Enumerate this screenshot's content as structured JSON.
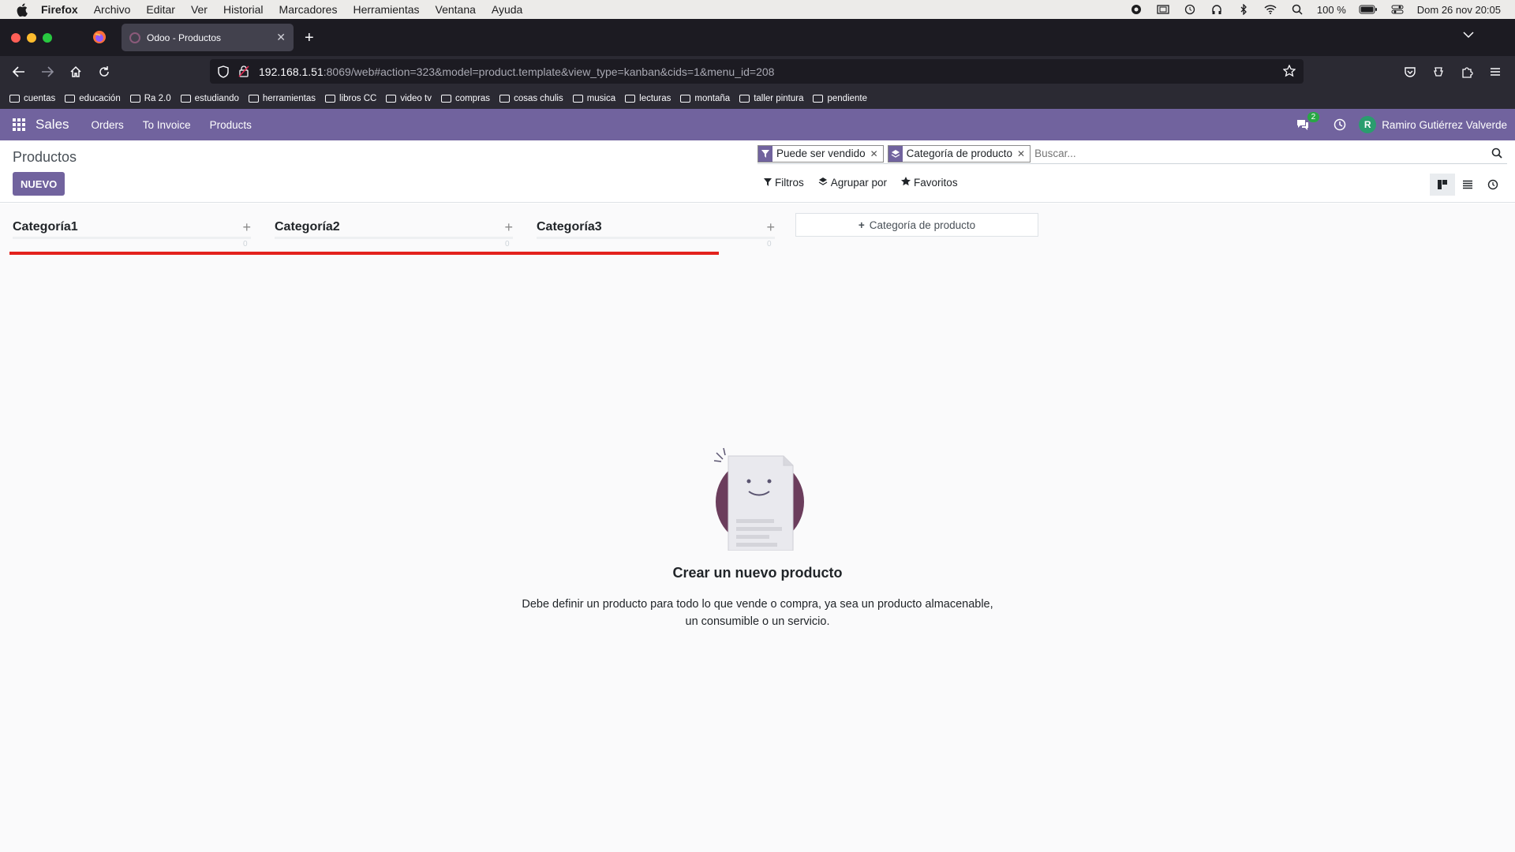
{
  "mac_menu": {
    "app": "Firefox",
    "items": [
      "Archivo",
      "Editar",
      "Ver",
      "Historial",
      "Marcadores",
      "Herramientas",
      "Ventana",
      "Ayuda"
    ],
    "battery": "100 %",
    "datetime": "Dom 26 nov  20:05"
  },
  "browser": {
    "tab_title": "Odoo - Productos",
    "url_host": "192.168.1.51",
    "url_rest": ":8069/web#action=323&model=product.template&view_type=kanban&cids=1&menu_id=208",
    "bookmarks": [
      "cuentas",
      "educación",
      "Ra 2.0",
      "estudiando",
      "herramientas",
      "libros CC",
      "video tv",
      "compras",
      "cosas chulis",
      "musica",
      "lecturas",
      "montaña",
      "taller pintura",
      "pendiente"
    ]
  },
  "odoo_nav": {
    "brand": "Sales",
    "menus": [
      "Orders",
      "To Invoice",
      "Products"
    ],
    "chat_badge": "2",
    "avatar_letter": "R",
    "user_name": "Ramiro Gutiérrez Valverde",
    "color": "#71639e"
  },
  "control_panel": {
    "breadcrumb": "Productos",
    "new_button": "NUEVO",
    "facets": [
      {
        "label": "Puede ser vendido",
        "icon": "filter-icon"
      },
      {
        "label": "Categoría de producto",
        "icon": "layers-icon"
      }
    ],
    "search_placeholder": "Buscar...",
    "filters_label": "Filtros",
    "groupby_label": "Agrupar por",
    "favorites_label": "Favoritos"
  },
  "kanban": {
    "columns": [
      {
        "title": "Categoría1",
        "count": "0"
      },
      {
        "title": "Categoría2",
        "count": "0"
      },
      {
        "title": "Categoría3",
        "count": "0"
      }
    ],
    "add_column_label": "Categoría de producto"
  },
  "helper": {
    "title": "Crear un nuevo producto",
    "text": "Debe definir un producto para todo lo que vende o compra, ya sea un producto almacenable, un consumible o un servicio."
  }
}
